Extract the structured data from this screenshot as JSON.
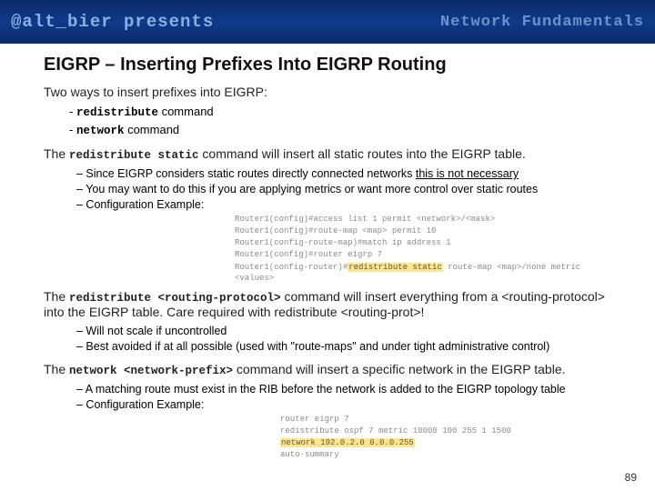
{
  "header": {
    "left": "@alt_bier presents",
    "right": "Network Fundamentals"
  },
  "title": "EIGRP – Inserting Prefixes Into EIGRP Routing",
  "intro": "Two ways to insert prefixes into EIGRP:",
  "ways": {
    "a_pre": "- ",
    "a_code": "redistribute",
    "a_post": " command",
    "b_pre": "- ",
    "b_code": "network",
    "b_post": " command"
  },
  "redistStatic": {
    "pre": "The ",
    "code": "redistribute static",
    "post": " command will insert all static routes into the EIGRP table.",
    "b1a": "– Since EIGRP considers static routes directly connected networks ",
    "b1b": "this is not necessary",
    "b2": "– You may want to do this if you are applying metrics or want more control over static routes",
    "b3": "– Configuration Example:"
  },
  "config1": {
    "l1": "Router1(config)#access list 1 permit <network>/<mask>",
    "gap1": " ",
    "l2": "Router1(config)#route-map <map> permit 10",
    "l3": "Router1(config-route-map)#match ip address 1",
    "gap2": " ",
    "l4": "Router1(config)#router eigrp 7",
    "l5a": "Router1(config-router)#",
    "l5hl": "redistribute static",
    "l5b": " route-map <map>/none metric <values>"
  },
  "redistProto": {
    "pre": "The ",
    "code": "redistribute <routing-protocol>",
    "post": " command will insert everything from a <routing-protocol> into the EIGRP table. Care required with redistribute <routing-prot>!",
    "b1": "– Will not scale if uncontrolled",
    "b2": "– Best avoided if at all possible (used with \"route-maps\" and under tight administrative control)"
  },
  "networkCmd": {
    "pre": "The ",
    "code": "network <network-prefix>",
    "post": " command will insert a specific network in the EIGRP table.",
    "b1": "– A matching route must exist in the RIB before the network is added to the EIGRP topology table",
    "b2": "– Configuration Example:"
  },
  "config2": {
    "l1": "router eigrp 7",
    "l2": " redistribute ospf 7 metric 10000 100 255 1 1500",
    "l3hl": " network 192.0.2.0 0.0.0.255",
    "l4": " auto-summary"
  },
  "pageNumber": "89"
}
